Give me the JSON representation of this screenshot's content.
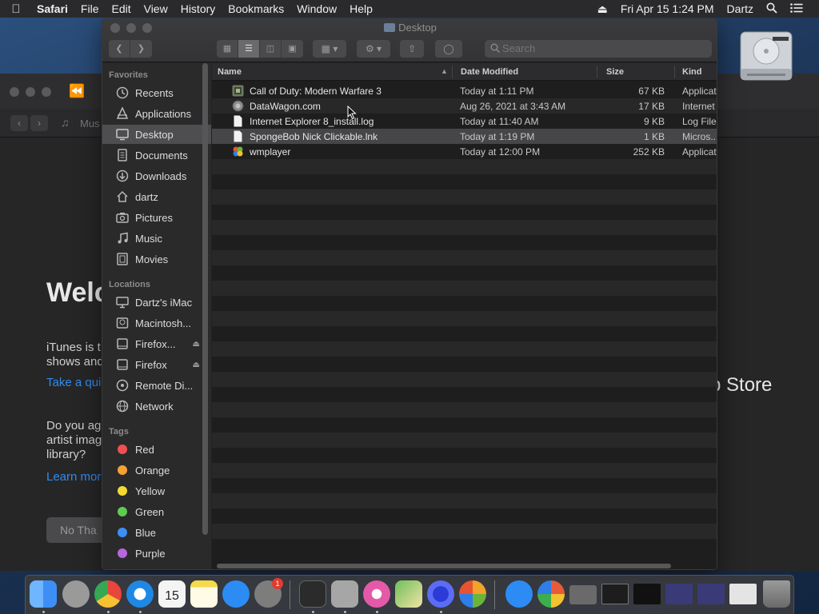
{
  "menubar": {
    "app": "Safari",
    "items": [
      "File",
      "Edit",
      "View",
      "History",
      "Bookmarks",
      "Window",
      "Help"
    ],
    "datetime": "Fri Apr 15  1:24 PM",
    "user": "Dartz"
  },
  "itunes": {
    "welcome": "Welc",
    "line1a": "iTunes is t",
    "line1b": "shows and",
    "link1": "Take a qui",
    "line2a": "Do you ag",
    "line2b": "artist imag",
    "line2c": "library?",
    "link2": "Learn mor",
    "nothanks": "No Tha",
    "appstore": "p Store",
    "music_tab": "Mus"
  },
  "finder": {
    "title": "Desktop",
    "search_placeholder": "Search",
    "sidebar": {
      "favorites_header": "Favorites",
      "favorites": [
        {
          "label": "Recents",
          "icon": "clock-icon"
        },
        {
          "label": "Applications",
          "icon": "applications-icon"
        },
        {
          "label": "Desktop",
          "icon": "desktop-icon",
          "selected": true
        },
        {
          "label": "Documents",
          "icon": "documents-icon"
        },
        {
          "label": "Downloads",
          "icon": "downloads-icon"
        },
        {
          "label": "dartz",
          "icon": "home-icon"
        },
        {
          "label": "Pictures",
          "icon": "pictures-icon"
        },
        {
          "label": "Music",
          "icon": "music-icon"
        },
        {
          "label": "Movies",
          "icon": "movies-icon"
        }
      ],
      "locations_header": "Locations",
      "locations": [
        {
          "label": "Dartz's iMac",
          "icon": "imac-icon"
        },
        {
          "label": "Macintosh...",
          "icon": "harddisk-icon"
        },
        {
          "label": "Firefox...",
          "icon": "disk-image-icon",
          "eject": true
        },
        {
          "label": "Firefox",
          "icon": "disk-image-icon",
          "eject": true
        },
        {
          "label": "Remote Di...",
          "icon": "remote-disc-icon"
        },
        {
          "label": "Network",
          "icon": "network-icon"
        }
      ],
      "tags_header": "Tags",
      "tags": [
        {
          "label": "Red",
          "color": "#f0504f"
        },
        {
          "label": "Orange",
          "color": "#f5a134"
        },
        {
          "label": "Yellow",
          "color": "#f5d931"
        },
        {
          "label": "Green",
          "color": "#5fcc4f"
        },
        {
          "label": "Blue",
          "color": "#3d8ff5"
        },
        {
          "label": "Purple",
          "color": "#b667db"
        }
      ]
    },
    "columns": {
      "name": "Name",
      "date": "Date Modified",
      "size": "Size",
      "kind": "Kind"
    },
    "files": [
      {
        "name": "Call of Duty: Modern Warfare 3",
        "date": "Today at 1:11 PM",
        "size": "67 KB",
        "kind": "Applicat",
        "icon": "app-icon"
      },
      {
        "name": "DataWagon.com",
        "date": "Aug 26, 2021 at 3:43 AM",
        "size": "17 KB",
        "kind": "Internet",
        "icon": "web-location-icon"
      },
      {
        "name": "Internet Explorer 8_install.log",
        "date": "Today at 11:40 AM",
        "size": "9 KB",
        "kind": "Log File",
        "icon": "document-icon"
      },
      {
        "name": "SpongeBob Nick Clickable.lnk",
        "date": "Today at 1:19 PM",
        "size": "1 KB",
        "kind": "Micros..",
        "icon": "document-icon",
        "selected": true
      },
      {
        "name": "wmplayer",
        "date": "Today at 12:00 PM",
        "size": "252 KB",
        "kind": "Applicat",
        "icon": "wmplayer-icon"
      }
    ]
  },
  "dock": {
    "apps": [
      {
        "name": "finder-icon",
        "color": "#3d8ff5"
      },
      {
        "name": "launchpad-icon",
        "color": "#9a9a9a"
      },
      {
        "name": "chrome-icon",
        "color": "#e8453c"
      },
      {
        "name": "safari-icon",
        "color": "#1e88e5"
      },
      {
        "name": "calendar-icon",
        "color": "#f4f4f4"
      },
      {
        "name": "notes-icon",
        "color": "#f7d94c"
      },
      {
        "name": "app-store-icon",
        "color": "#2c8cf4"
      },
      {
        "name": "system-preferences-icon",
        "color": "#7d7d7d"
      },
      {
        "name": "terminal-icon",
        "color": "#2b2b2b"
      },
      {
        "name": "archive-utility-icon",
        "color": "#a6a6a6"
      },
      {
        "name": "itunes-icon",
        "color": "#e45aa8"
      },
      {
        "name": "maps-icon",
        "color": "#6fbf5a"
      },
      {
        "name": "firefox-icon",
        "color": "#5b6cf5"
      },
      {
        "name": "picasa-icon",
        "color": "#f2a32b"
      },
      {
        "name": "app-store-icon-2",
        "color": "#2c8cf4"
      },
      {
        "name": "pinwheel-icon",
        "color": "#e85b3a"
      },
      {
        "name": "screenshot-icon",
        "color": "#6a6a6a"
      },
      {
        "name": "window-thumb-icon",
        "color": "#1d1d1d"
      },
      {
        "name": "window-thumb-icon-2",
        "color": "#111"
      },
      {
        "name": "window-thumb-icon-3",
        "color": "#3a3a78"
      },
      {
        "name": "window-thumb-icon-4",
        "color": "#3a3a78"
      },
      {
        "name": "preview-icon",
        "color": "#e4e4e4"
      },
      {
        "name": "trash-icon",
        "color": "#8a8a8a"
      }
    ],
    "calendar_day": "15",
    "sysprefs_badge": "1"
  }
}
